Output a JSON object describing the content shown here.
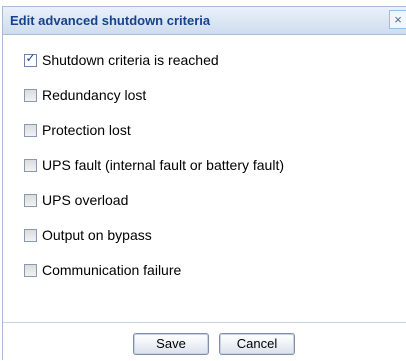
{
  "dialog": {
    "title": "Edit advanced shutdown criteria",
    "close_glyph": "×"
  },
  "options": [
    {
      "label": "Shutdown criteria is reached",
      "checked": true
    },
    {
      "label": "Redundancy lost",
      "checked": false
    },
    {
      "label": "Protection lost",
      "checked": false
    },
    {
      "label": "UPS fault (internal fault or battery fault)",
      "checked": false
    },
    {
      "label": "UPS overload",
      "checked": false
    },
    {
      "label": "Output on bypass",
      "checked": false
    },
    {
      "label": "Communication failure",
      "checked": false
    }
  ],
  "check_glyph": "✓",
  "buttons": {
    "save_label": "Save",
    "cancel_label": "Cancel"
  },
  "colors": {
    "title_text": "#15428b",
    "border": "#a7bcd6"
  }
}
